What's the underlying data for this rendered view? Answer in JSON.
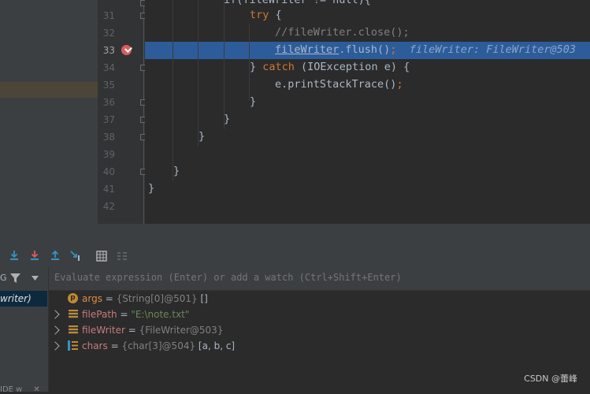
{
  "editor": {
    "line_numbers": [
      "31",
      "32",
      "33",
      "34",
      "35",
      "36",
      "37",
      "38",
      "39",
      "40",
      "41",
      "42"
    ],
    "current_line": "33",
    "lines": {
      "l30_partial": "if(fileWriter != null){",
      "l31_try": "try",
      "l31_brace": " {",
      "l32_comment": "//fileWriter.close();",
      "l33_obj": "fileWriter",
      "l33_call": ".flush()",
      "l33_semi": ";",
      "l33_inline": "fileWriter: FileWriter@503",
      "l34_close": "} ",
      "l34_catch": "catch",
      "l34_rest": " (IOException e) {",
      "l35_call": "e.printStackTrace()",
      "l35_semi": ";",
      "brace": "}"
    }
  },
  "debug": {
    "watch_placeholder": "Evaluate expression (Enter) or add a watch (Ctrl+Shift+Enter)",
    "frame_selected": "writer)",
    "frames_header_letter": "G",
    "bottom_tab": "IDE w",
    "variables": [
      {
        "name": "args",
        "eq": " = ",
        "type": "{String[0]@501}",
        "value": " []",
        "icon": "parameter-icon",
        "expandable": false
      },
      {
        "name": "filePath",
        "eq": " = ",
        "type": "",
        "value": "\"E:\\note.txt\"",
        "icon": "field-icon",
        "expandable": true
      },
      {
        "name": "fileWriter",
        "eq": " = ",
        "type": "{FileWriter@503}",
        "value": "",
        "icon": "field-icon",
        "expandable": true
      },
      {
        "name": "chars",
        "eq": " = ",
        "type": "{char[3]@504}",
        "value": " [a, b, c]",
        "icon": "array-icon",
        "expandable": true
      }
    ]
  },
  "watermark": "CSDN @蕾峰",
  "colors": {
    "exec_line": "#2d5c9b",
    "keyword": "#cc7832",
    "breakpoint": "#db5c5c"
  }
}
